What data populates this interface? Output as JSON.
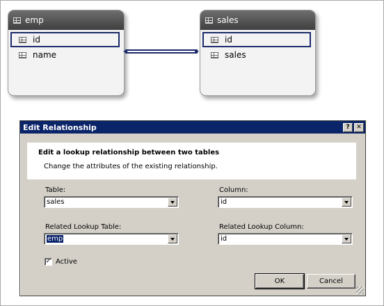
{
  "diagram": {
    "emp_table": {
      "title": "emp",
      "fields": [
        "id",
        "name"
      ]
    },
    "sales_table": {
      "title": "sales",
      "fields": [
        "id",
        "sales"
      ]
    }
  },
  "dialog": {
    "title": "Edit Relationship",
    "help_label": "?",
    "close_label": "✕",
    "heading": "Edit a lookup relationship between two tables",
    "subheading": "Change the attributes of the existing relationship.",
    "table_label": "Table:",
    "table_value": "sales",
    "column_label": "Column:",
    "column_value": "id",
    "related_table_label": "Related Lookup Table:",
    "related_table_value": "emp",
    "related_column_label": "Related Lookup Column:",
    "related_column_value": "id",
    "active_label": "Active",
    "active_checked": true,
    "ok_label": "OK",
    "cancel_label": "Cancel"
  }
}
